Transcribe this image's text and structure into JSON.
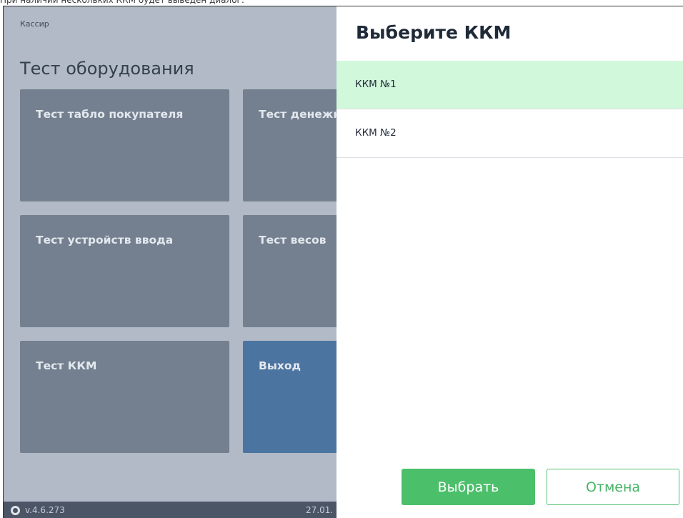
{
  "caption": "При наличии нескольких ККМ будет выведен диалог:",
  "background_app": {
    "user": "Кассир",
    "title": "Тест оборудования",
    "tiles": [
      {
        "label": "Тест табло покупателя"
      },
      {
        "label": "Тест денежного ящика"
      },
      {
        "label": "Тест устройств ввода"
      },
      {
        "label": "Тест весов"
      },
      {
        "label": "Тест ККМ"
      },
      {
        "label": "Выход"
      }
    ],
    "status_bar": {
      "version": "v.4.6.273",
      "date": "27.01."
    }
  },
  "dialog": {
    "title": "Выберите ККМ",
    "items": [
      {
        "label": "ККМ №1",
        "selected": true
      },
      {
        "label": "ККМ №2",
        "selected": false
      }
    ],
    "buttons": {
      "select": "Выбрать",
      "cancel": "Отмена"
    }
  },
  "colors": {
    "selected_row": "#d2f8dc",
    "primary_button": "#4cbf6b",
    "exit_tile": "#4c74a0"
  }
}
